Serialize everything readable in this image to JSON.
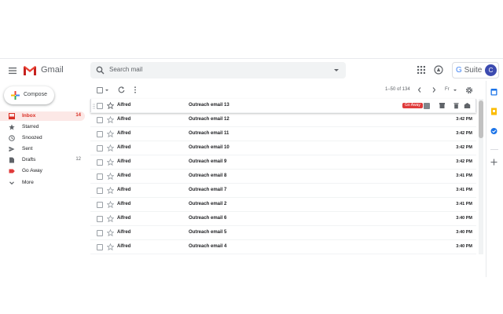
{
  "header": {
    "app_name": "Gmail",
    "search_placeholder": "Search mail",
    "gsuite_g": "G",
    "gsuite_label": "Suite",
    "avatar_letter": "C"
  },
  "sidebar": {
    "compose_label": "Compose",
    "items": [
      {
        "label": "Inbox",
        "count": "14",
        "icon": "inbox-icon",
        "active": true
      },
      {
        "label": "Starred",
        "count": "",
        "icon": "star-icon"
      },
      {
        "label": "Snoozed",
        "count": "",
        "icon": "clock-icon"
      },
      {
        "label": "Sent",
        "count": "",
        "icon": "send-icon"
      },
      {
        "label": "Drafts",
        "count": "12",
        "icon": "draft-icon"
      },
      {
        "label": "Go Away",
        "count": "",
        "icon": "label-icon"
      },
      {
        "label": "More",
        "count": "",
        "icon": "chevron-down-icon"
      }
    ]
  },
  "toolbar": {
    "pager": "1–50 of 134",
    "language": "Fr"
  },
  "emails": [
    {
      "sender": "Alfred",
      "subject": "Outreach email 13",
      "time": "",
      "label": "Go Away"
    },
    {
      "sender": "Alfred",
      "subject": "Outreach email 12",
      "time": "3:42 PM"
    },
    {
      "sender": "Alfred",
      "subject": "Outreach email 11",
      "time": "3:42 PM"
    },
    {
      "sender": "Alfred",
      "subject": "Outreach email 10",
      "time": "3:42 PM"
    },
    {
      "sender": "Alfred",
      "subject": "Outreach email 9",
      "time": "3:42 PM"
    },
    {
      "sender": "Alfred",
      "subject": "Outreach email 8",
      "time": "3:41 PM"
    },
    {
      "sender": "Alfred",
      "subject": "Outreach email 7",
      "time": "3:41 PM"
    },
    {
      "sender": "Alfred",
      "subject": "Outreach email 2",
      "time": "3:41 PM"
    },
    {
      "sender": "Alfred",
      "subject": "Outreach email 6",
      "time": "3:40 PM"
    },
    {
      "sender": "Alfred",
      "subject": "Outreach email 5",
      "time": "3:40 PM"
    },
    {
      "sender": "Alfred",
      "subject": "Outreach email 4",
      "time": "3:40 PM"
    }
  ],
  "colors": {
    "accent_red": "#d93025",
    "active_bg": "#fce8e6",
    "label_red": "#e03a3a",
    "avatar_bg": "#3c4bb0"
  }
}
